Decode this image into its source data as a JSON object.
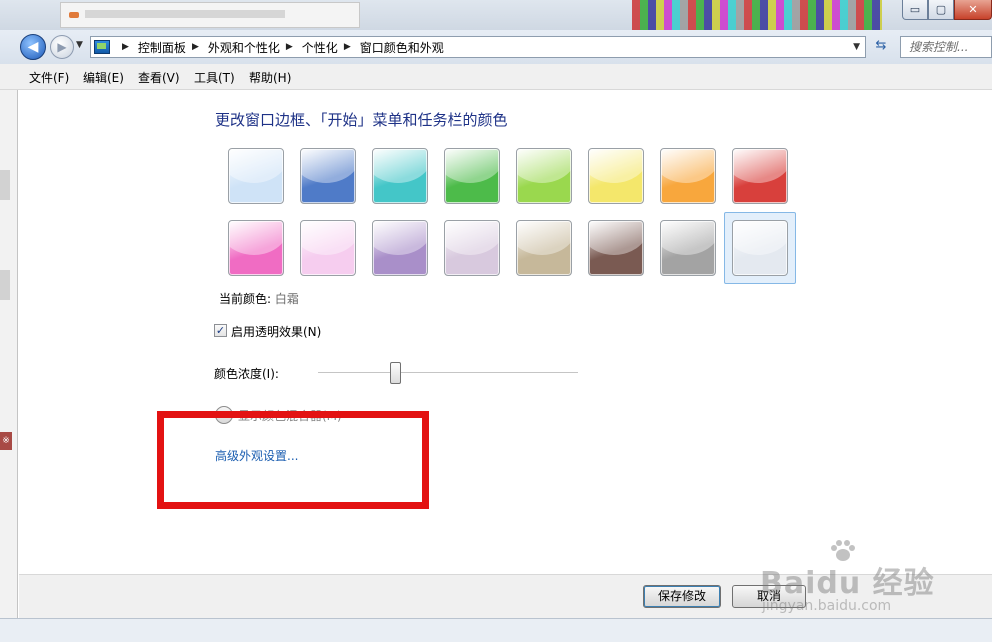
{
  "window": {
    "controls": {
      "minimize": "▭",
      "maximize": "▢",
      "close": "✕"
    }
  },
  "nav": {
    "breadcrumbs": [
      "控制面板",
      "外观和个性化",
      "个性化",
      "窗口颜色和外观"
    ],
    "search_placeholder": "搜索控制...",
    "back_icon": "back-arrow-icon",
    "forward_icon": "forward-arrow-icon",
    "refresh_icon": "refresh-icon"
  },
  "menu": {
    "items": [
      "文件(F)",
      "编辑(E)",
      "查看(V)",
      "工具(T)",
      "帮助(H)"
    ]
  },
  "main": {
    "heading": "更改窗口边框、「开始」菜单和任务栏的颜色",
    "swatches": [
      {
        "name": "sky",
        "color": "#cfe3f7"
      },
      {
        "name": "twilight",
        "color": "#4f7bc8"
      },
      {
        "name": "sea",
        "color": "#44c6c8"
      },
      {
        "name": "leaf",
        "color": "#4dbb4a"
      },
      {
        "name": "lime",
        "color": "#9ad84e"
      },
      {
        "name": "lemon",
        "color": "#f4e76b"
      },
      {
        "name": "pumpkin",
        "color": "#f8a73d"
      },
      {
        "name": "ruby",
        "color": "#d8403c"
      },
      {
        "name": "fuchsia",
        "color": "#f06cc3"
      },
      {
        "name": "blush",
        "color": "#f6cdef"
      },
      {
        "name": "violet",
        "color": "#a98fc9"
      },
      {
        "name": "lavender",
        "color": "#d8c9de"
      },
      {
        "name": "taupe",
        "color": "#c6b89a"
      },
      {
        "name": "chocolate",
        "color": "#7a5a52"
      },
      {
        "name": "slate",
        "color": "#a3a3a3"
      },
      {
        "name": "frost",
        "color": "#e4e9f0"
      }
    ],
    "selected_swatch_index": 15,
    "current_color_label": "当前颜色:",
    "current_color_value": "白霜",
    "transparency_label": "启用透明效果(N)",
    "transparency_checked": true,
    "intensity_label": "颜色浓度(I):",
    "intensity_value": 0.3,
    "mixer_label": "显示颜色混合器(M)",
    "advanced_link": "高级外观设置..."
  },
  "footer": {
    "save_label": "保存修改",
    "cancel_label": "取消"
  },
  "annotation": {
    "color": "#e31212"
  },
  "watermark": {
    "logo": "Baidu 经验",
    "url": "jingyan.baidu.com"
  }
}
